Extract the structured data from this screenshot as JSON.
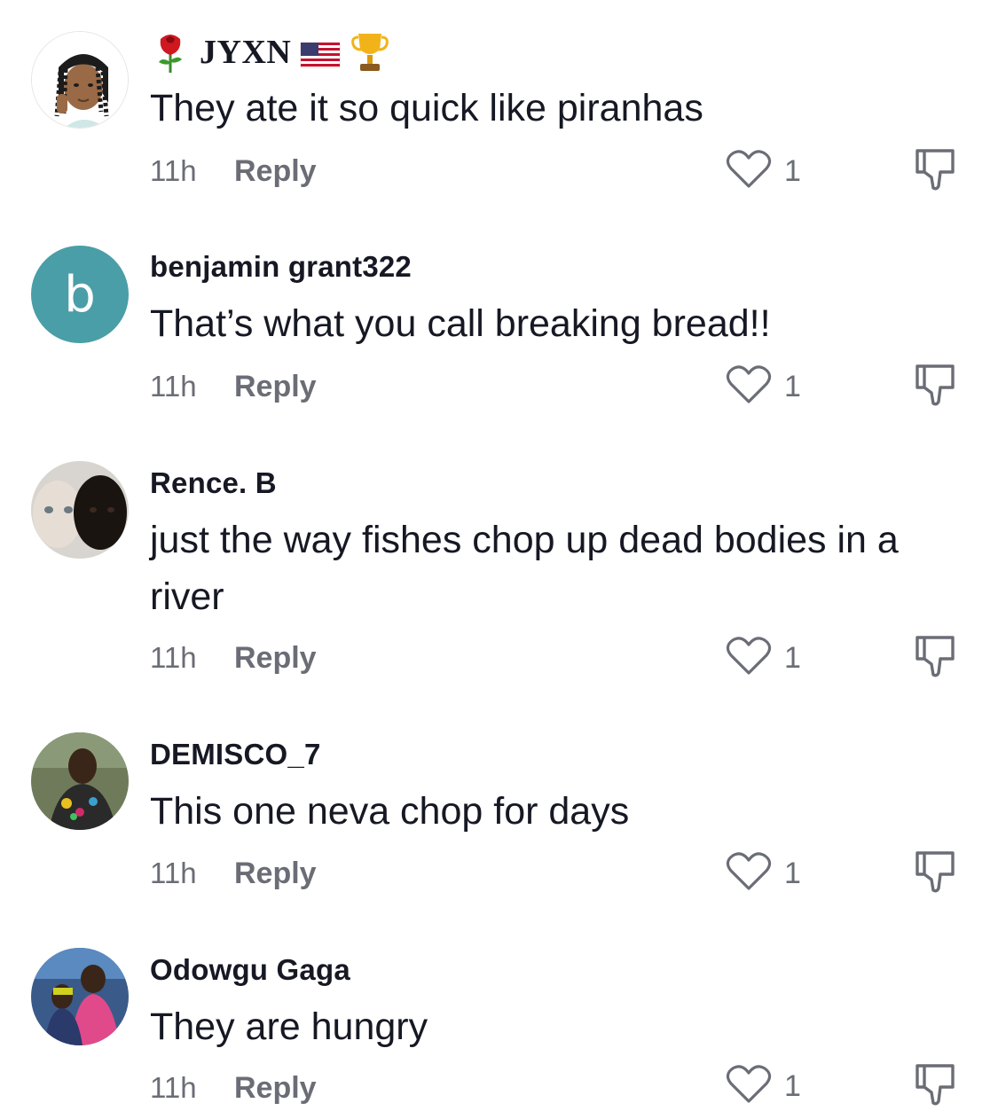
{
  "comments": [
    {
      "username": "JYXN",
      "text": "They ate it so quick like piranhas",
      "time": "11h",
      "reply_label": "Reply",
      "likes": "1",
      "avatar": "cartoon-avatar",
      "name_emojis": [
        "rose-icon",
        "us-flag-icon",
        "trophy-icon"
      ]
    },
    {
      "username": "benjamin grant322",
      "text": "That’s what you call breaking bread!!",
      "time": "11h",
      "reply_label": "Reply",
      "likes": "1",
      "avatar_letter": "b",
      "avatar_color": "#4a9ea7"
    },
    {
      "username": "Rence. B",
      "text": "just the way fishes chop up dead bodies in a river",
      "time": "11h",
      "reply_label": "Reply",
      "likes": "1",
      "avatar": "photo-avatar"
    },
    {
      "username": "DEMISCO_7",
      "text": "This one neva chop for days",
      "time": "11h",
      "reply_label": "Reply",
      "likes": "1",
      "avatar": "photo-avatar"
    },
    {
      "username": "Odowgu Gaga",
      "text": "They are hungry",
      "time": "11h",
      "reply_label": "Reply",
      "likes": "1",
      "avatar": "photo-avatar"
    }
  ],
  "colors": {
    "text": "#161823",
    "secondary": "#6b6d76",
    "icon_stroke": "#6b6d76"
  }
}
